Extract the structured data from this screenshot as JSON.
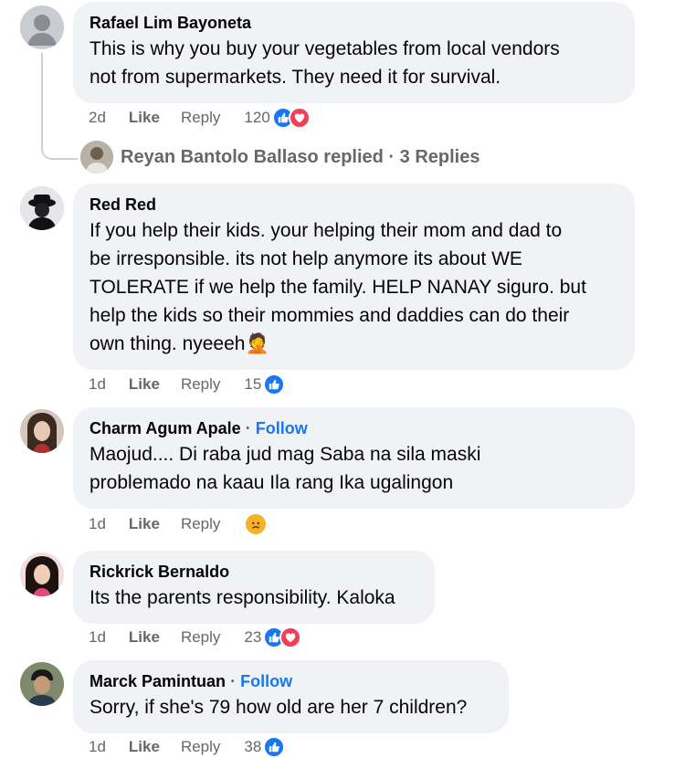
{
  "comments": [
    {
      "author": "Rafael Lim Bayoneta",
      "follow": "",
      "lines": [
        "This is why you buy your vegetables from local vendors",
        "not from supermarkets. They need it for survival."
      ],
      "time": "2d",
      "like": "Like",
      "reply": "Reply",
      "reactions_count": "120",
      "reactions": [
        "like-icon",
        "love-icon"
      ],
      "replies": {
        "name": "Reyan Bantolo Ballaso",
        "label": "replied",
        "sep": "·",
        "count": "3 Replies"
      }
    },
    {
      "author": "Red Red",
      "follow": "",
      "lines": [
        "If you help their kids. your helping their mom and dad to",
        "be irresponsible. its not help anymore its about WE",
        "TOLERATE if we help the family. HELP NANAY siguro. but",
        "help the kids so their mommies and daddies can do their",
        "own thing. nyeeeh🤦"
      ],
      "time": "1d",
      "like": "Like",
      "reply": "Reply",
      "reactions_count": "15",
      "reactions": [
        "like-icon"
      ]
    },
    {
      "author": "Charm Agum Apale",
      "sep": "·",
      "follow": "Follow",
      "lines": [
        "Maojud.... Di raba jud mag Saba na sila maski",
        "problemado na kaau Ila rang Ika ugalingon"
      ],
      "time": "1d",
      "like": "Like",
      "reply": "Reply",
      "reactions_count": "",
      "reactions": [
        "sad-icon"
      ]
    },
    {
      "author": "Rickrick Bernaldo",
      "follow": "",
      "lines": [
        "Its the parents responsibility. Kaloka"
      ],
      "time": "1d",
      "like": "Like",
      "reply": "Reply",
      "reactions_count": "23",
      "reactions": [
        "like-icon",
        "love-icon"
      ]
    },
    {
      "author": "Marck Pamintuan",
      "sep": "·",
      "follow": "Follow",
      "lines": [
        "Sorry, if she's 79 how old are her 7 children?"
      ],
      "time": "1d",
      "like": "Like",
      "reply": "Reply",
      "reactions_count": "38",
      "reactions": [
        "like-icon"
      ]
    }
  ],
  "colors": {
    "link_blue": "#1877f2",
    "bubble_bg": "#f0f2f5",
    "muted": "#65676b",
    "love_red": "#f33e58",
    "sad_yellow": "#f7b125"
  }
}
